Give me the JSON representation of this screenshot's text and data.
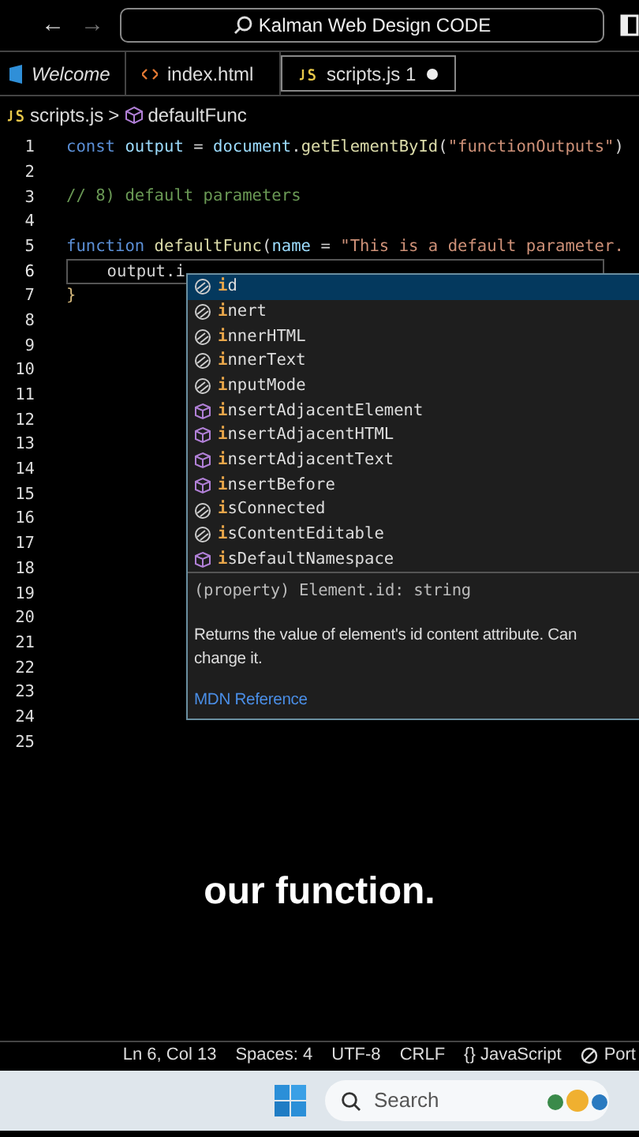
{
  "title_bar": {
    "back": "←",
    "forward": "→",
    "search": "Kalman Web Design CODE"
  },
  "tabs": [
    {
      "label": "Welcome",
      "kind": "welcome",
      "selected": false,
      "modified": false
    },
    {
      "label": "index.html",
      "kind": "html",
      "selected": false,
      "modified": false
    },
    {
      "label": "scripts.js",
      "problems": "1",
      "kind": "js",
      "selected": true,
      "modified": true
    }
  ],
  "breadcrumb": {
    "file": "scripts.js",
    "separator": ">",
    "symbol": "defaultFunc"
  },
  "code_lines": [
    {
      "number": "1",
      "tokens": [
        {
          "text": "const ",
          "kind": "keyword"
        },
        {
          "text": "output",
          "kind": "variable"
        },
        {
          "text": " = ",
          "kind": "plain"
        },
        {
          "text": "document",
          "kind": "variable"
        },
        {
          "text": ".",
          "kind": "plain"
        },
        {
          "text": "getElementById",
          "kind": "function"
        },
        {
          "text": "(",
          "kind": "plain"
        },
        {
          "text": "\"functionOutputs\"",
          "kind": "string"
        },
        {
          "text": ")",
          "kind": "plain"
        }
      ]
    },
    {
      "number": "2"
    },
    {
      "number": "3",
      "tokens": [
        {
          "text": "// 8) default parameters",
          "kind": "comment"
        }
      ]
    },
    {
      "number": "4"
    },
    {
      "number": "5",
      "tokens": [
        {
          "text": "function ",
          "kind": "keyword"
        },
        {
          "text": "defaultFunc",
          "kind": "function"
        },
        {
          "text": "(",
          "kind": "plain"
        },
        {
          "text": "name",
          "kind": "variable"
        },
        {
          "text": " = ",
          "kind": "plain"
        },
        {
          "text": "\"This is a default parameter.",
          "kind": "string"
        }
      ]
    },
    {
      "number": "6",
      "current": true,
      "tokens": [
        {
          "text": "    output.i",
          "kind": "plain"
        }
      ]
    },
    {
      "number": "7",
      "tokens": [
        {
          "text": "}",
          "kind": "bracket"
        }
      ]
    },
    {
      "number": "8"
    },
    {
      "number": "9"
    },
    {
      "number": "10"
    },
    {
      "number": "11"
    },
    {
      "number": "12"
    },
    {
      "number": "13"
    },
    {
      "number": "14"
    },
    {
      "number": "15"
    },
    {
      "number": "16"
    },
    {
      "number": "17"
    },
    {
      "number": "18"
    },
    {
      "number": "19"
    },
    {
      "number": "20"
    },
    {
      "number": "21"
    },
    {
      "number": "22"
    },
    {
      "number": "23"
    },
    {
      "number": "24"
    },
    {
      "number": "25"
    }
  ],
  "suggestions": [
    {
      "match": "i",
      "rest": "d",
      "kind": "property",
      "selected": true
    },
    {
      "match": "i",
      "rest": "nert",
      "kind": "property",
      "selected": false
    },
    {
      "match": "i",
      "rest": "nnerHTML",
      "kind": "property",
      "selected": false
    },
    {
      "match": "i",
      "rest": "nnerText",
      "kind": "property",
      "selected": false
    },
    {
      "match": "i",
      "rest": "nputMode",
      "kind": "property",
      "selected": false
    },
    {
      "match": "i",
      "rest": "nsertAdjacentElement",
      "kind": "method",
      "selected": false
    },
    {
      "match": "i",
      "rest": "nsertAdjacentHTML",
      "kind": "method",
      "selected": false
    },
    {
      "match": "i",
      "rest": "nsertAdjacentText",
      "kind": "method",
      "selected": false
    },
    {
      "match": "i",
      "rest": "nsertBefore",
      "kind": "method",
      "selected": false
    },
    {
      "match": "i",
      "rest": "sConnected",
      "kind": "property",
      "selected": false
    },
    {
      "match": "i",
      "rest": "sContentEditable",
      "kind": "property",
      "selected": false
    },
    {
      "match": "i",
      "rest": "sDefaultNamespace",
      "kind": "method",
      "selected": false
    }
  ],
  "details": {
    "signature": "(property) Element.id: string",
    "description": "Returns the value of element's id content attribute. Can",
    "description_2": "change it.",
    "link": "MDN Reference"
  },
  "caption": "our function.",
  "status_bar": [
    "Ln 6, Col 13",
    "Spaces: 4",
    "UTF-8",
    "CRLF",
    "{} JavaScript"
  ],
  "status_port": "Port",
  "taskbar": {
    "search_placeholder": "Search"
  }
}
